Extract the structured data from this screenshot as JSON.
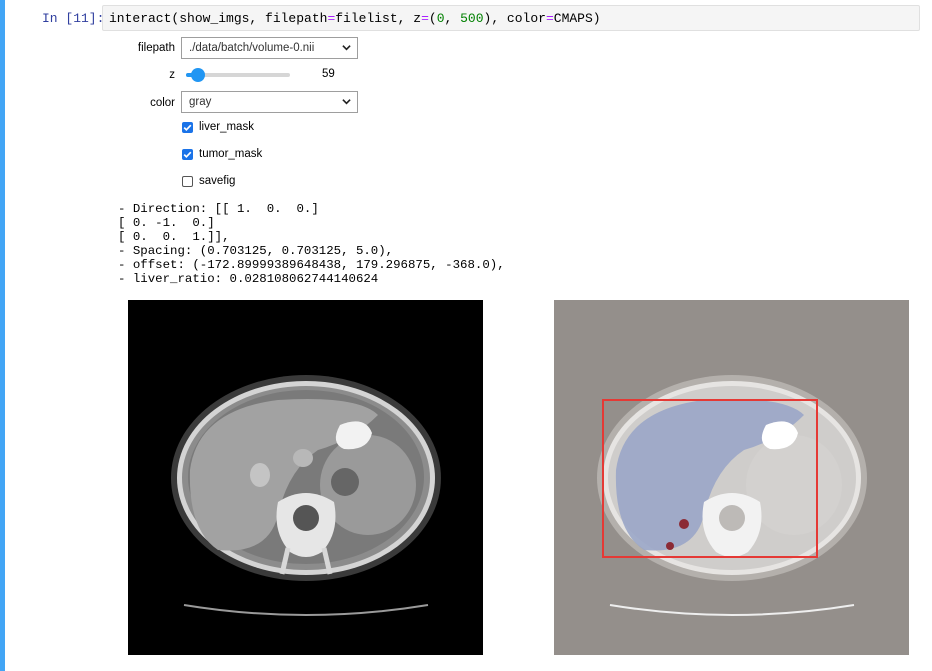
{
  "cell": {
    "prompt": "In [11]:",
    "code": {
      "t1": "interact(show_imgs, filepath",
      "eq1": "=",
      "t2": "filelist, z",
      "eq2": "=",
      "t3": "(",
      "n1": "0",
      "t4": ", ",
      "n2": "500",
      "t5": "), color",
      "eq3": "=",
      "t6": "CMAPS)"
    }
  },
  "widgets": {
    "filepath": {
      "label": "filepath",
      "value": "./data/batch/volume-0.nii"
    },
    "z": {
      "label": "z",
      "value": "59",
      "min": 0,
      "max": 500,
      "level": 0.118
    },
    "color": {
      "label": "color",
      "value": "gray"
    },
    "liver_mask": {
      "label": "liver_mask",
      "checked": true
    },
    "tumor_mask": {
      "label": "tumor_mask",
      "checked": true
    },
    "savefig": {
      "label": "savefig",
      "checked": false
    }
  },
  "output_lines": [
    "- Direction: [[ 1.  0.  0.]",
    "[ 0. -1.  0.]",
    "[ 0.  0.  1.]],",
    "- Spacing: (0.703125, 0.703125, 5.0),",
    "- offset: (-172.89999389648438, 179.296875, -368.0),",
    "- liver_ratio: 0.028108062744140624"
  ],
  "colors": {
    "accent": "#2196f3",
    "cell_bar": "#42a5f5",
    "bbox": "#e53935",
    "liver_overlay": "#9aa6c8",
    "tumor_overlay": "#8b2a35"
  }
}
